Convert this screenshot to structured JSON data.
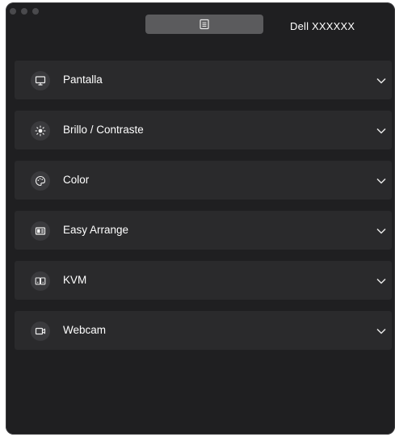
{
  "window": {
    "header_tab_icon": "document-icon",
    "monitor_name": "Dell XXXXXX"
  },
  "sections": [
    {
      "label": "Pantalla",
      "icon": "monitor-icon",
      "expanded": false
    },
    {
      "label": "Brillo / Contraste",
      "icon": "brightness-icon",
      "expanded": false
    },
    {
      "label": "Color",
      "icon": "palette-icon",
      "expanded": false
    },
    {
      "label": "Easy Arrange",
      "icon": "layout-icon",
      "expanded": false
    },
    {
      "label": "KVM",
      "icon": "kvm-icon",
      "expanded": false
    },
    {
      "label": "Webcam",
      "icon": "webcam-icon",
      "expanded": false
    }
  ],
  "colors": {
    "window_bg": "#1f1f21",
    "row_bg": "#2a2a2c",
    "tab_bg": "#5b5b5d",
    "text": "#ffffff"
  }
}
